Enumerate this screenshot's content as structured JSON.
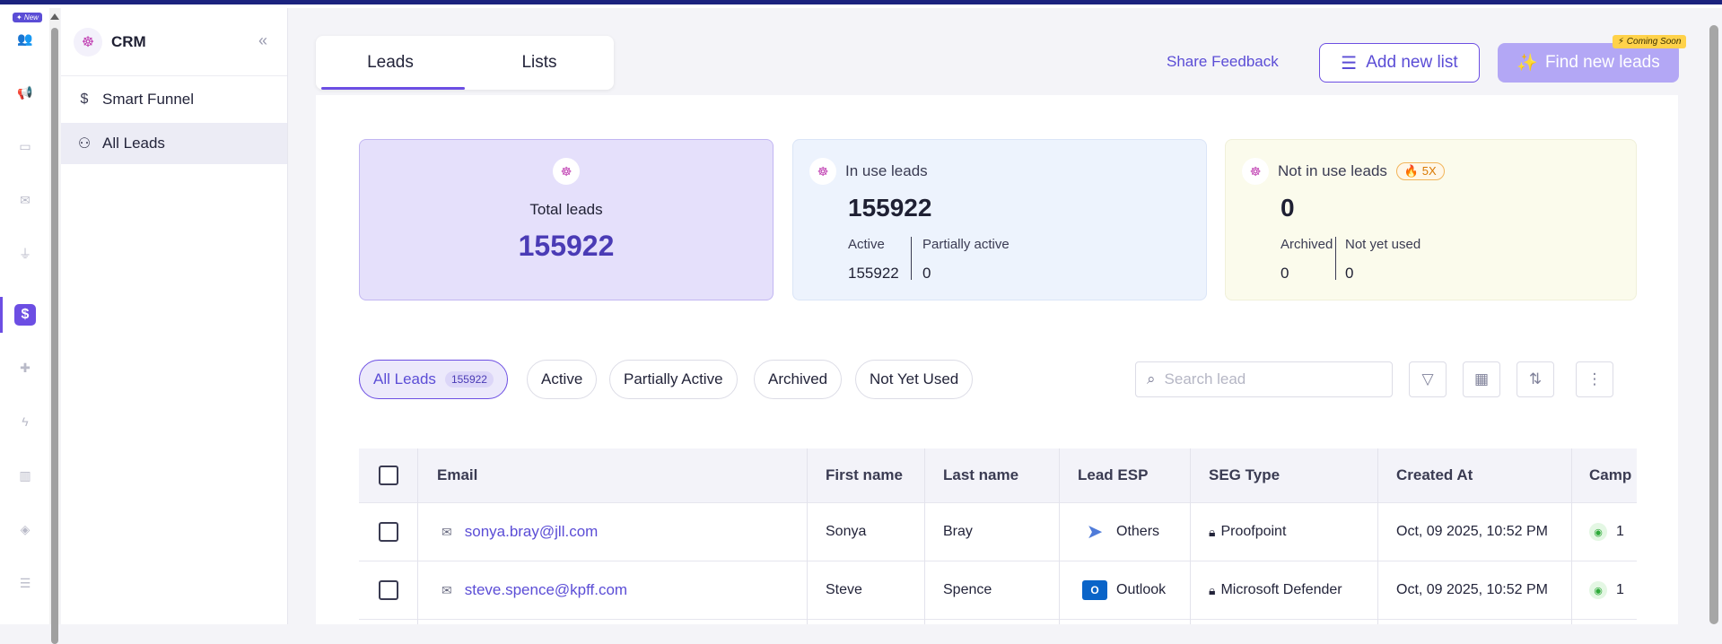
{
  "rail": {
    "new_badge": "✦ New",
    "icons": [
      "users-icon",
      "megaphone-icon",
      "inbox-icon",
      "mail-icon",
      "plug-icon",
      "dollar-icon",
      "puzzle-icon",
      "bolt-icon",
      "chart-icon",
      "layers-icon",
      "list-icon"
    ],
    "active_icon": "dollar-icon"
  },
  "sidebar": {
    "title": "CRM",
    "items": [
      {
        "label": "Smart Funnel",
        "icon": "dollar-icon"
      },
      {
        "label": "All Leads",
        "icon": "user-group-icon"
      }
    ]
  },
  "tabs": [
    {
      "label": "Leads",
      "active": true
    },
    {
      "label": "Lists",
      "active": false
    }
  ],
  "header": {
    "share_feedback": "Share Feedback",
    "add_new_list": "Add new list",
    "find_new_leads": "Find new leads",
    "coming_soon": "⚡ Coming Soon"
  },
  "stats": {
    "total": {
      "label": "Total leads",
      "value": "155922"
    },
    "in_use": {
      "label": "In use leads",
      "value": "155922",
      "active_label": "Active",
      "active_value": "155922",
      "partial_label": "Partially active",
      "partial_value": "0"
    },
    "not_in_use": {
      "label": "Not in use leads",
      "badge": "5X",
      "value": "0",
      "archived_label": "Archived",
      "archived_value": "0",
      "not_yet_label": "Not yet used",
      "not_yet_value": "0"
    }
  },
  "filters": {
    "chips": [
      {
        "label": "All Leads",
        "count": "155922",
        "active": true
      },
      {
        "label": "Active"
      },
      {
        "label": "Partially Active"
      },
      {
        "label": "Archived"
      },
      {
        "label": "Not Yet Used"
      }
    ],
    "search_placeholder": "Search lead"
  },
  "table": {
    "columns": [
      "Email",
      "First name",
      "Last name",
      "Lead ESP",
      "SEG Type",
      "Created At",
      "Camp"
    ],
    "rows": [
      {
        "email": "sonya.bray@jll.com",
        "first": "Sonya",
        "last": "Bray",
        "esp": "Others",
        "seg": "Proofpoint",
        "created": "Oct, 09 2025, 10:52 PM",
        "camp": "1"
      },
      {
        "email": "steve.spence@kpff.com",
        "first": "Steve",
        "last": "Spence",
        "esp": "Outlook",
        "seg": "Microsoft Defender",
        "created": "Oct, 09 2025, 10:52 PM",
        "camp": "1"
      }
    ]
  },
  "colors": {
    "accent": "#6c4ee3",
    "link": "#5b4dd6",
    "total_card": "#e5e0fb",
    "inuse_card": "#edf3fd",
    "notuse_card": "#fbfbec"
  }
}
